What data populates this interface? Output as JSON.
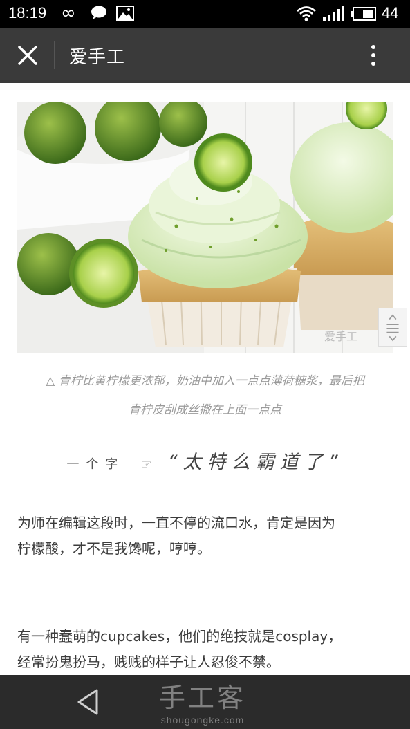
{
  "status_bar": {
    "time": "18:19",
    "battery_level": "44",
    "icons": [
      "infinity-icon",
      "chat-bubble-icon",
      "image-icon",
      "wifi-icon",
      "signal-icon",
      "battery-icon"
    ]
  },
  "app_bar": {
    "title": "爱手工",
    "close_icon": "close-icon",
    "menu_icon": "more-vertical-icon",
    "background": "#3a3a3a"
  },
  "article": {
    "image": {
      "subject": "lime cupcakes",
      "watermark": "爱手工"
    },
    "caption_line1": "△ 青柠比黄柠檬更浓郁，奶油中加入一点点薄荷糖浆，最后把",
    "caption_line2": "青柠皮刮成丝撒在上面一点点",
    "quote": {
      "lead": "一个字",
      "hand": "☞",
      "text": "“太特么霸道了”"
    },
    "paragraph1_line1": "为师在编辑这段时，一直不停的流口水，肯定是因为",
    "paragraph1_line2": "柠檬酸，才不是我馋呢，哼哼。",
    "paragraph2_line1": "有一种蠢萌的cupcakes，他们的绝技就是cosplay，",
    "paragraph2_line2": "经常扮鬼扮马，贱贱的样子让人忍俊不禁。"
  },
  "nav_bar": {
    "back_icon": "back-triangle-icon",
    "watermark_title": "手工客",
    "watermark_url": "shougongke.com"
  }
}
